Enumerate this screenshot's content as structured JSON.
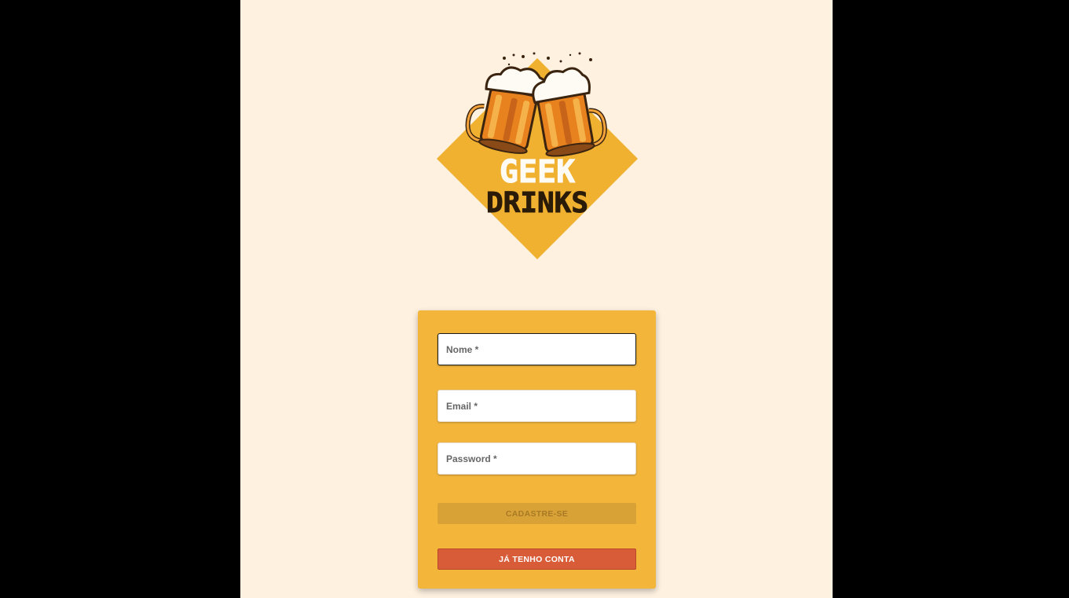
{
  "app": {
    "logo_alt": "Geek Drinks logo",
    "logo_line1": "GEEK",
    "logo_line2": "DRINKS"
  },
  "form": {
    "name_placeholder": "Nome *",
    "email_placeholder": "Email *",
    "password_placeholder": "Password *",
    "signup_label": "CADASTRE-SE",
    "login_label": "JÁ TENHO CONTA"
  },
  "colors": {
    "page_background": "#fef1e0",
    "card": "#f3b63b",
    "logo_diamond": "#f0b030",
    "signup_disabled": "#d8a237",
    "login_button": "#d85c38"
  },
  "icons": [
    "beer-mugs-icon"
  ]
}
